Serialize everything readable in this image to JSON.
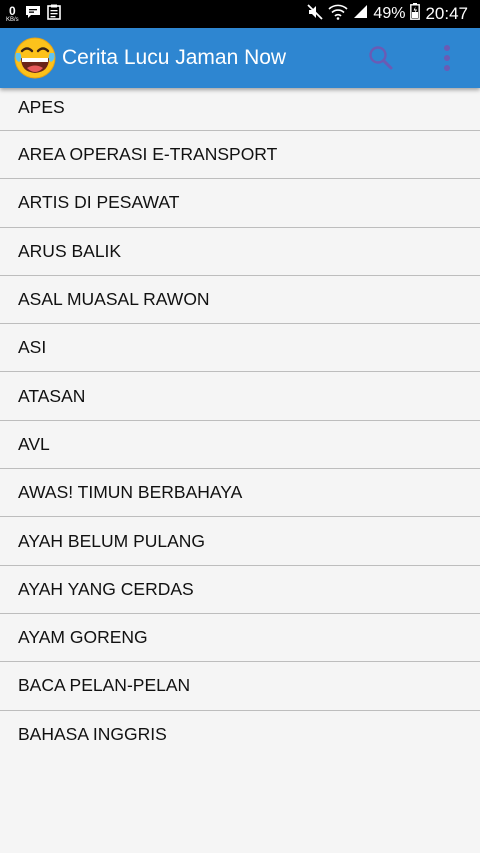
{
  "status_bar": {
    "speed_value": "0",
    "speed_unit": "KB/s",
    "battery": "49%",
    "time": "20:47",
    "icons": [
      "chat-notification-icon",
      "clipboard-notification-icon",
      "mute-icon",
      "wifi-icon",
      "signal-icon",
      "battery-icon"
    ]
  },
  "app_bar": {
    "title": "Cerita Lucu Jaman Now",
    "logo_icon": "laughing-emoji-icon",
    "actions": [
      "search-icon",
      "overflow-menu-icon"
    ],
    "color": "#2e86d1"
  },
  "stories": [
    "APES",
    "AREA OPERASI E-TRANSPORT",
    "ARTIS DI PESAWAT",
    "ARUS BALIK",
    "ASAL MUASAL RAWON",
    "ASI",
    "ATASAN",
    "AVL",
    "AWAS! TIMUN BERBAHAYA",
    "AYAH BELUM PULANG",
    "AYAH YANG CERDAS",
    "AYAM GORENG",
    "BACA PELAN-PELAN",
    "BAHASA INGGRIS"
  ]
}
